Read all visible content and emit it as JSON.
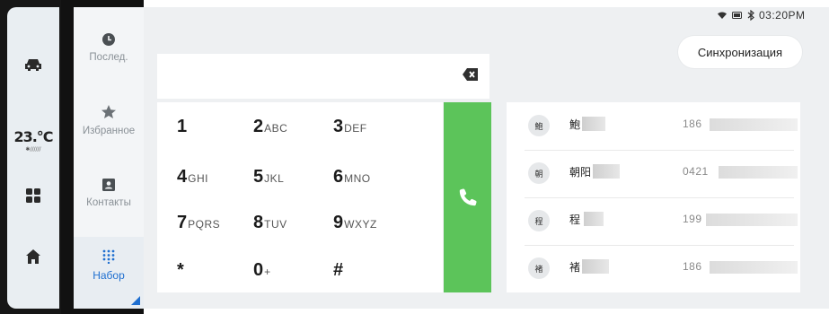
{
  "status_bar": {
    "time": "03:20PM",
    "icons": [
      "wifi-icon",
      "battery-icon",
      "bluetooth-icon"
    ]
  },
  "left_rail": {
    "temperature": "23.⁰℃",
    "temperature_display": "23.°C",
    "items": [
      "car-icon",
      "grid-icon",
      "home-icon"
    ]
  },
  "phone_nav": {
    "items": [
      {
        "label": "Послед.",
        "icon": "clock-icon"
      },
      {
        "label": "Избранное",
        "icon": "star-icon"
      },
      {
        "label": "Контакты",
        "icon": "contact-card-icon"
      },
      {
        "label": "Набор",
        "icon": "dialpad-icon",
        "active": true
      }
    ]
  },
  "dialer": {
    "input_value": "",
    "keys": [
      {
        "digit": "1",
        "letters": ""
      },
      {
        "digit": "2",
        "letters": "ABC"
      },
      {
        "digit": "3",
        "letters": "DEF"
      },
      {
        "digit": "4",
        "letters": "GHI"
      },
      {
        "digit": "5",
        "letters": "JKL"
      },
      {
        "digit": "6",
        "letters": "MNO"
      },
      {
        "digit": "7",
        "letters": "PQRS"
      },
      {
        "digit": "8",
        "letters": "TUV"
      },
      {
        "digit": "9",
        "letters": "WXYZ"
      },
      {
        "digit": "*",
        "letters": ""
      },
      {
        "digit": "0",
        "letters": "+"
      },
      {
        "digit": "#",
        "letters": ""
      }
    ]
  },
  "sync_button": {
    "label": "Синхронизация"
  },
  "contacts": [
    {
      "avatar": "鮑",
      "name": "鮑",
      "number": "186"
    },
    {
      "avatar": "朝",
      "name": "朝阳",
      "number": "0421"
    },
    {
      "avatar": "程",
      "name": "程",
      "number": "199"
    },
    {
      "avatar": "褚",
      "name": "褚",
      "number": "186"
    }
  ],
  "colors": {
    "accent": "#1f6fd0",
    "call_green": "#5cc45a"
  }
}
